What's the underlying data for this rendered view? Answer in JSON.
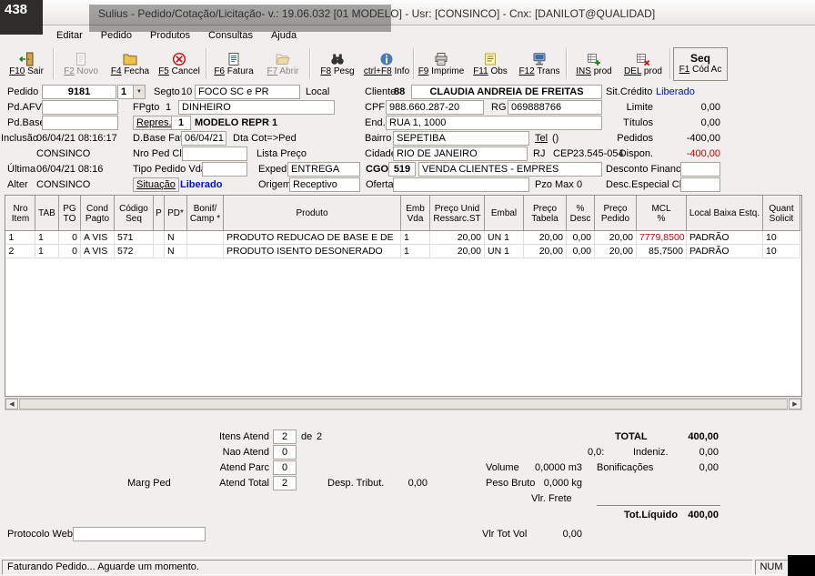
{
  "overlay": {
    "badge": "438"
  },
  "titlebar": {
    "title": "Sulius - Pedido/Cotação/Licitação- v.: 19.06.032  [01 MODELO] - Usr: [CONSINCO] - Cnx: [DANILOT@QUALIDAD]"
  },
  "menubar": {
    "items": [
      "Editar",
      "Pedido",
      "Produtos",
      "Consultas",
      "Ajuda"
    ]
  },
  "toolbar": {
    "buttons": [
      {
        "key": "F10",
        "label": "Sair",
        "icon": "exit-icon",
        "enabled": true
      },
      {
        "key": "F2",
        "label": "Novo",
        "icon": "new-document-icon",
        "enabled": false
      },
      {
        "key": "F4",
        "label": "Fecha",
        "icon": "closed-folder-icon",
        "enabled": true
      },
      {
        "key": "F5",
        "label": "Cancel",
        "icon": "cancel-icon",
        "enabled": true
      },
      {
        "key": "F6",
        "label": "Fatura",
        "icon": "invoice-icon",
        "enabled": true
      },
      {
        "key": "F7",
        "label": "Abrir",
        "icon": "open-folder-icon",
        "enabled": false
      },
      {
        "key": "F8",
        "label": "Pesg",
        "icon": "binoculars-icon",
        "enabled": true
      },
      {
        "key": "ctrl+F8",
        "label": "Info",
        "icon": "info-icon",
        "enabled": true
      },
      {
        "key": "F9",
        "label": "Imprime",
        "icon": "printer-icon",
        "enabled": true
      },
      {
        "key": "F11",
        "label": "Obs",
        "icon": "notes-icon",
        "enabled": true
      },
      {
        "key": "F12",
        "label": "Trans",
        "icon": "transfer-icon",
        "enabled": true
      },
      {
        "key": "INS",
        "label": "prod",
        "icon": "insert-row-icon",
        "enabled": true
      },
      {
        "key": "DEL",
        "label": "prod",
        "icon": "delete-row-icon",
        "enabled": true
      }
    ],
    "seq_title": "Seq",
    "seq_key": "F1",
    "seq_label": "Cód Ac"
  },
  "form": {
    "pedido_label": "Pedido",
    "pedido_value": "9181",
    "pedido_seq": "1",
    "segto_label": "Segto",
    "segto_value": "10",
    "segto_desc": "FOCO SC e PR",
    "local_label": "Local",
    "cliente_label": "Cliente",
    "cliente_code": "88",
    "cliente_nome": "CLAUDIA ANDREIA DE FREITAS",
    "sitcred_label": "Sit.Crédito",
    "sitcred_value": "Liberado",
    "pdafv_label": "Pd.AFV",
    "fpgto_label": "FPgto",
    "fpgto_value": "1",
    "fpgto_desc": "DINHEIRO",
    "cpf_label": "CPF",
    "cpf_value": "988.660.287-20",
    "rg_label": "RG",
    "rg_value": "069888766",
    "limite_label": "Limite",
    "limite_value": "0,00",
    "pdbase_label": "Pd.Base",
    "repres_label": "Repres.",
    "repres_value": "1",
    "repres_desc": "MODELO REPR 1",
    "end_label": "End.",
    "end_value": "RUA 1, 1000",
    "titulos_label": "Títulos",
    "titulos_value": "0,00",
    "inclusao_label": "Inclusão",
    "inclusao_value": "06/04/21 08:16:17",
    "inclusao_user": "CONSINCO",
    "dbasefat_label": "D.Base Fat",
    "dbasefat_value": "06/04/21",
    "dtacot_label": "Dta Cot=>Ped",
    "bairro_label": "Bairro",
    "bairro_value": "SEPETIBA",
    "tel_label": "Tel",
    "tel_value": "()",
    "pedidos_label": "Pedidos",
    "pedidos_value": "-400,00",
    "nropedcli_label": "Nro Ped Cli",
    "listapreco_label": "Lista Preço",
    "cidade_label": "Cidade",
    "cidade_value": "RIO DE JANEIRO",
    "uf_value": "RJ",
    "cep_label": "CEP",
    "cep_value": "23.545-054",
    "dispon_label": "Dispon.",
    "dispon_value": "-400,00",
    "ultima_label": "Última",
    "ultima_value": "06/04/21 08:16",
    "tipoped_label": "Tipo Pedido Vda",
    "exped_label": "Exped",
    "exped_value": "ENTREGA",
    "cgo_label": "CGO",
    "cgo_value": "519",
    "cgo_desc": "VENDA CLIENTES - EMPRES",
    "descfin_label": "Desconto Financ.",
    "alter_label": "Alter",
    "alter_value": "CONSINCO",
    "situacao_label": "Situação",
    "situacao_value": "Liberado",
    "origem_label": "Origem",
    "origem_value": "Receptivo",
    "oferta_label": "Oferta",
    "pzomax_label": "Pzo Max",
    "pzomax_value": "0",
    "descesp_label": "Desc.Especial Cli."
  },
  "grid": {
    "headers": [
      "Nro\nItem",
      "TAB",
      "PG\nTO",
      "Cond\nPagto",
      "Código\nSeq",
      "P",
      "PD*",
      "Bonif/\nCamp *",
      "Produto",
      "Emb\nVda",
      "Preço Unid\nRessarc.ST",
      "Embal",
      "Preço\nTabela",
      "%\nDesc",
      "Preço\nPedido",
      "MCL\n%",
      "Local Baixa Estq.",
      "Quant\nSolicit"
    ],
    "rows": [
      {
        "nro": "1",
        "tab": "1",
        "pg": "0",
        "cond": "A VIS",
        "codigo": "571",
        "p": "",
        "pd": "N",
        "bonif": "",
        "produto": "PRODUTO REDUCAO DE BASE E DE",
        "emb": "1",
        "preco_unid": "20,00",
        "embal": "UN 1",
        "preco_tab": "20,00",
        "desc": "0,00",
        "preco_ped": "20,00",
        "mcl": "7779,8500",
        "local": "PADRÃO",
        "quant": "10"
      },
      {
        "nro": "2",
        "tab": "1",
        "pg": "0",
        "cond": "A VIS",
        "codigo": "572",
        "p": "",
        "pd": "N",
        "bonif": "",
        "produto": "PRODUTO ISENTO DESONERADO",
        "emb": "1",
        "preco_unid": "20,00",
        "embal": "UN 1",
        "preco_tab": "20,00",
        "desc": "0,00",
        "preco_ped": "20,00",
        "mcl": "85,7500",
        "local": "PADRÃO",
        "quant": "10"
      }
    ]
  },
  "summary": {
    "itens_atend_label": "Itens Atend",
    "itens_atend_value": "2",
    "de_label": "de",
    "itens_total_value": "2",
    "nao_atend_label": "Nao Atend",
    "nao_atend_value": "0",
    "atend_parc_label": "Atend Parc",
    "atend_parc_value": "0",
    "marg_ped_label": "Marg Ped",
    "atend_total_label": "Atend Total",
    "atend_total_value": "2",
    "desp_tribut_label": "Desp. Tribut.",
    "desp_tribut_value": "0,00",
    "volume_label": "Volume",
    "volume_value": "0,0000 m3",
    "peso_label": "Peso Bruto",
    "peso_value": "0,000 kg",
    "frete_label": "Vlr. Frete",
    "total_label": "TOTAL",
    "total_value": "400,00",
    "indeniz_prefix": "0,0:",
    "indeniz_label": "Indeniz.",
    "indeniz_value": "0,00",
    "bonif_label": "Bonificações",
    "bonif_value": "0,00",
    "liquido_label": "Tot.Líquido",
    "liquido_value": "400,00",
    "protocolo_label": "Protocolo Web",
    "vlrtotvol_label": "Vlr Tot Vol",
    "vlrtotvol_value": "0,00"
  },
  "statusbar": {
    "message": "Faturando Pedido... Aguarde um momento.",
    "keyboard": "NUM"
  },
  "colors": {
    "credit_ok_blue": "#0014c8",
    "negative_red": "#d40000",
    "mcl_alert_red": "#d40000"
  }
}
